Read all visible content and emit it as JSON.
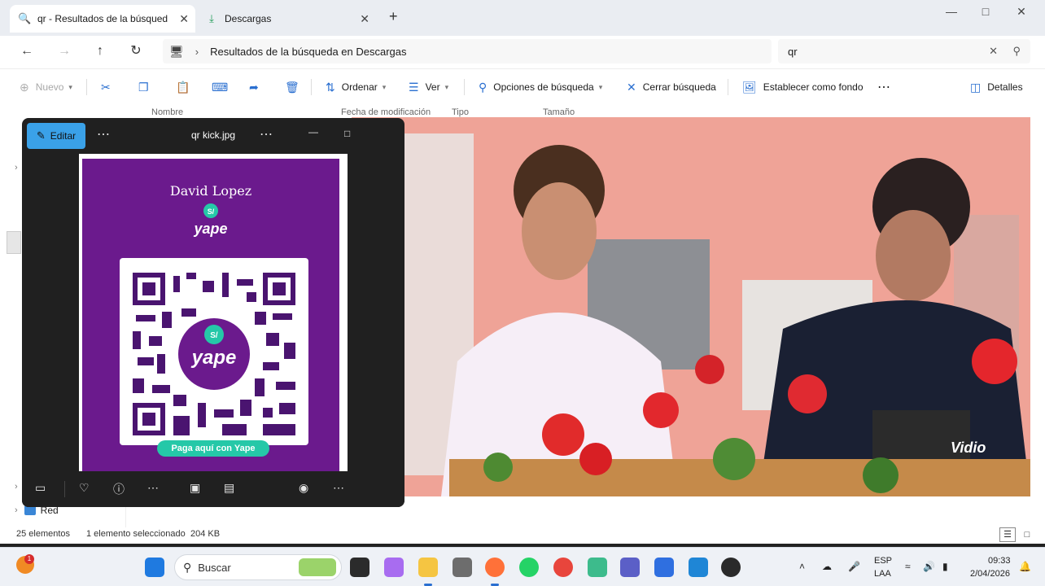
{
  "tabs": [
    {
      "label": "qr - Resultados de la búsqued",
      "icon": "search-icon"
    },
    {
      "label": "Descargas",
      "icon": "download-icon"
    }
  ],
  "address": {
    "path": "Resultados de la búsqueda en Descargas",
    "search_value": "qr"
  },
  "commands": {
    "nuevo": "Nuevo",
    "ordenar": "Ordenar",
    "ver": "Ver",
    "opciones": "Opciones de búsqueda",
    "cerrar": "Cerrar búsqueda",
    "fondo": "Establecer como fondo",
    "detalles": "Detalles"
  },
  "columns": {
    "nombre": "Nombre",
    "fecha": "Fecha de modificación",
    "tipo": "Tipo",
    "tamano": "Tamaño"
  },
  "nav": {
    "red": "Red"
  },
  "status": {
    "count": "25 elementos",
    "selected": "1 elemento seleccionado",
    "size": "204 KB"
  },
  "viewer": {
    "edit_label": "Editar",
    "title": "qr kick.jpg"
  },
  "qr_image": {
    "name": "David Lopez",
    "brand": "yape",
    "symbol": "S/",
    "pill": "Paga aquí con Yape"
  },
  "video": {
    "watermark": "Vidio"
  },
  "taskbar": {
    "search_label": "Buscar",
    "widget_badge": "1",
    "lang_top": "ESP",
    "lang_bottom": "LAA",
    "time": "09:33",
    "date": "2/04/2026"
  },
  "colors": {
    "accent": "#3aa1e8",
    "qr_purple": "#6b1a8d",
    "yape_teal": "#25c8a8",
    "video_bg": "#f0a89c"
  }
}
